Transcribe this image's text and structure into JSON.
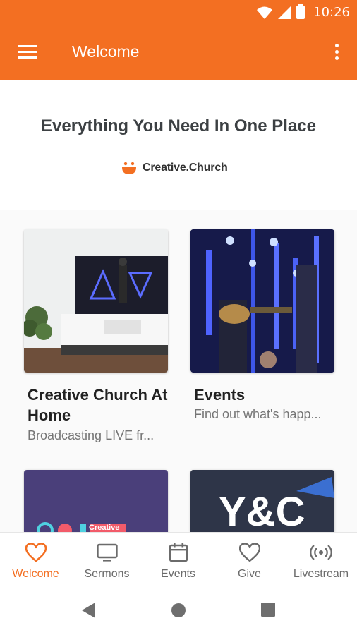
{
  "status_bar": {
    "time": "10:26"
  },
  "app_bar": {
    "title": "Welcome"
  },
  "hero": {
    "title": "Everything You Need In One Place",
    "brand": "Creative.Church"
  },
  "cards": [
    {
      "title": "Creative Church At Home",
      "subtitle": "Broadcasting LIVE fr..."
    },
    {
      "title": "Events",
      "subtitle": "Find out what's happ..."
    },
    {
      "title": "",
      "subtitle": "",
      "thumb_text": "Creative"
    },
    {
      "title": "",
      "subtitle": "",
      "thumb_text": "Y&C"
    }
  ],
  "bottom_nav": [
    {
      "label": "Welcome",
      "icon": "heart-icon",
      "active": true
    },
    {
      "label": "Sermons",
      "icon": "tv-icon"
    },
    {
      "label": "Events",
      "icon": "calendar-icon"
    },
    {
      "label": "Give",
      "icon": "heart-outline-icon"
    },
    {
      "label": "Livestream",
      "icon": "broadcast-icon"
    }
  ],
  "colors": {
    "accent": "#f36f22",
    "text": "#212121",
    "subtext": "#757575"
  }
}
